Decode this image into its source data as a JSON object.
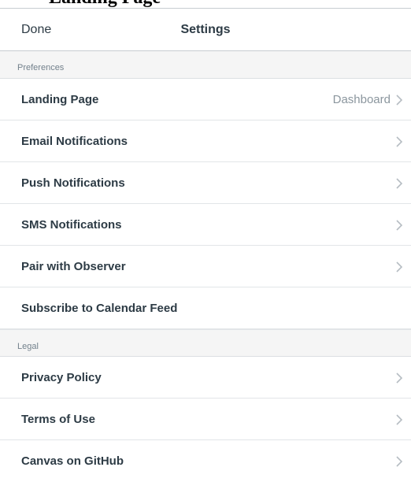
{
  "page_title": "Landing Page",
  "header": {
    "done_label": "Done",
    "title": "Settings"
  },
  "sections": [
    {
      "title": "Preferences",
      "items": [
        {
          "label": "Landing Page",
          "value": "Dashboard",
          "icon": "chevron-right-icon"
        },
        {
          "label": "Email Notifications",
          "icon": "chevron-right-icon"
        },
        {
          "label": "Push Notifications",
          "icon": "chevron-right-icon"
        },
        {
          "label": "SMS Notifications",
          "icon": "chevron-right-icon"
        },
        {
          "label": "Pair with Observer",
          "icon": "chevron-right-icon"
        },
        {
          "label": "Subscribe to Calendar Feed"
        }
      ]
    },
    {
      "title": "Legal",
      "items": [
        {
          "label": "Privacy Policy",
          "icon": "chevron-right-icon"
        },
        {
          "label": "Terms of Use",
          "icon": "chevron-right-icon"
        },
        {
          "label": "Canvas on GitHub",
          "icon": "chevron-right-icon"
        }
      ]
    }
  ],
  "colors": {
    "text": "#2d3b45",
    "secondary": "#8b969e",
    "section_bg": "#f5f5f5"
  }
}
